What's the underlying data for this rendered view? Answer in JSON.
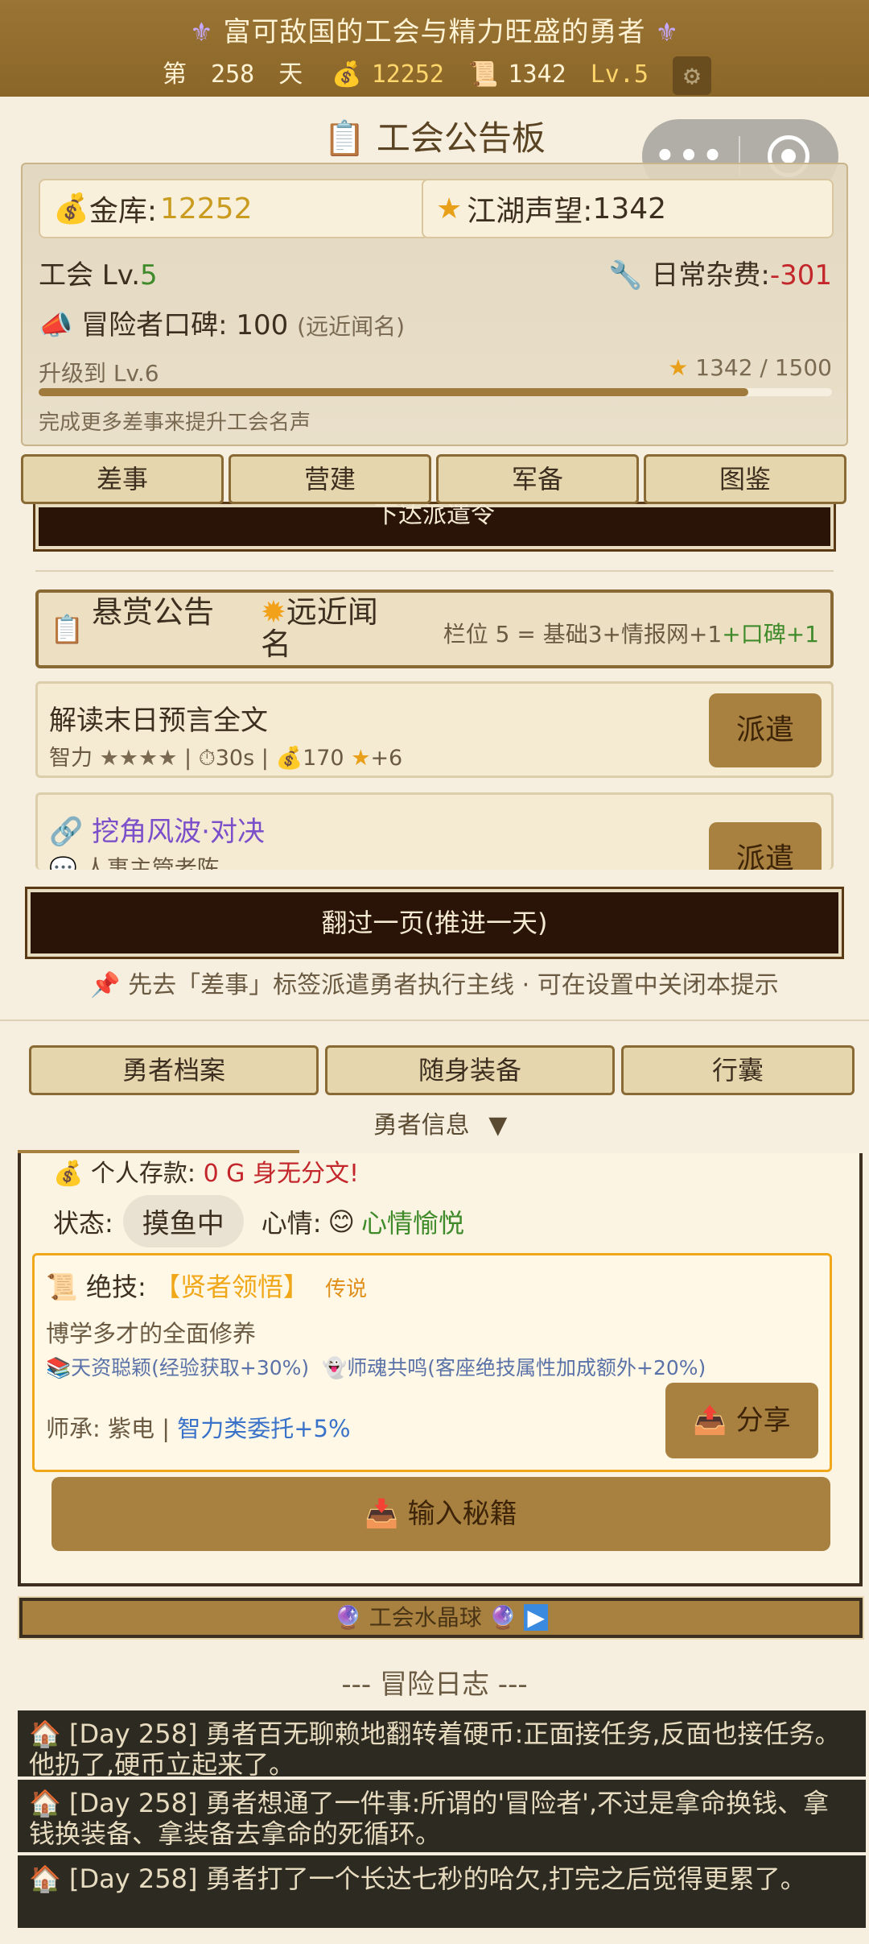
{
  "header": {
    "title": "富可敌国的工会与精力旺盛的勇者",
    "day_prefix": "第",
    "day_value": "258",
    "day_suffix": "天",
    "gold": "12252",
    "reputation": "1342",
    "level": "Lv.5"
  },
  "board": {
    "title": "工会公告板",
    "treasury_label": "金库:",
    "treasury_value": "12252",
    "fame_label": "江湖声望:",
    "fame_value": "1342",
    "guild_level_label": "工会 Lv.",
    "guild_level_value": "5",
    "daily_cost_label": "日常杂费:",
    "daily_cost_value": "-301",
    "word_of_mouth": "冒险者口碑: 100",
    "word_of_mouth_note": "(远近闻名)",
    "upgrade_label": "升级到 Lv.6",
    "upgrade_progress": "1342 / 1500",
    "progress_fraction": 0.895,
    "hint": "完成更多差事来提升工会名声"
  },
  "tabs": [
    "差事",
    "营建",
    "军备",
    "图鉴"
  ],
  "order_banner": "下达派遣令",
  "bounty": {
    "title": "悬赏公告",
    "rank": "远近闻名",
    "slots_text": "栏位 5 = 基础3+情报网+1",
    "slots_bonus": "+口碑+1"
  },
  "quests": [
    {
      "name": "解读末日预言全文",
      "attr": "智力",
      "stars": "★★★★",
      "time": "30s",
      "gold": "170",
      "fame": "+6",
      "button": "派遣"
    },
    {
      "name": "挖角风波·对决",
      "sub": "人事主管老陈",
      "button": "派遣"
    }
  ],
  "next_day_button": "翻过一页(推进一天)",
  "tip": "先去「差事」标签派遣勇者执行主线 · 可在设置中关闭本提示",
  "hero_tabs": [
    "勇者档案",
    "随身装备",
    "行囊"
  ],
  "hero_info_toggle": "勇者信息",
  "hero": {
    "savings_label": "个人存款:",
    "savings_value": "0 G",
    "savings_note": "身无分文!",
    "status_label": "状态:",
    "status_value": "摸鱼中",
    "mood_label": "心情:",
    "mood_value": "心情愉悦",
    "skill_label": "绝技:",
    "skill_name": "【贤者领悟】",
    "skill_rarity": "传说",
    "skill_desc": "博学多才的全面修养",
    "trait_1": "天资聪颖(经验获取+30%)",
    "trait_2": "师魂共鸣(客座绝技属性加成额外+20%)",
    "lineage_label": "师承: 紫电",
    "lineage_bonus": "智力类委托+5%",
    "share_button": "分享",
    "secret_button": "输入秘籍"
  },
  "crystal_ball": "工会水晶球",
  "log": {
    "title": "--- 冒险日志 ---",
    "entries": [
      "[Day 258] 勇者百无聊赖地翻转着硬币:正面接任务,反面也接任务。他扔了,硬币立起来了。",
      "[Day 258] 勇者想通了一件事:所谓的'冒险者',不过是拿命换钱、拿钱换装备、拿装备去拿命的死循环。",
      "[Day 258] 勇者打了一个长达七秒的哈欠,打完之后觉得更累了。"
    ]
  },
  "colors": {
    "header_bg": "#8a6628",
    "accent_gold": "#c99b1f",
    "button_brown": "#a8803f",
    "negative_red": "#c3262b",
    "positive_green": "#3f8a2a",
    "link_purple": "#7a4fc9",
    "legend_orange": "#f0a81a"
  }
}
